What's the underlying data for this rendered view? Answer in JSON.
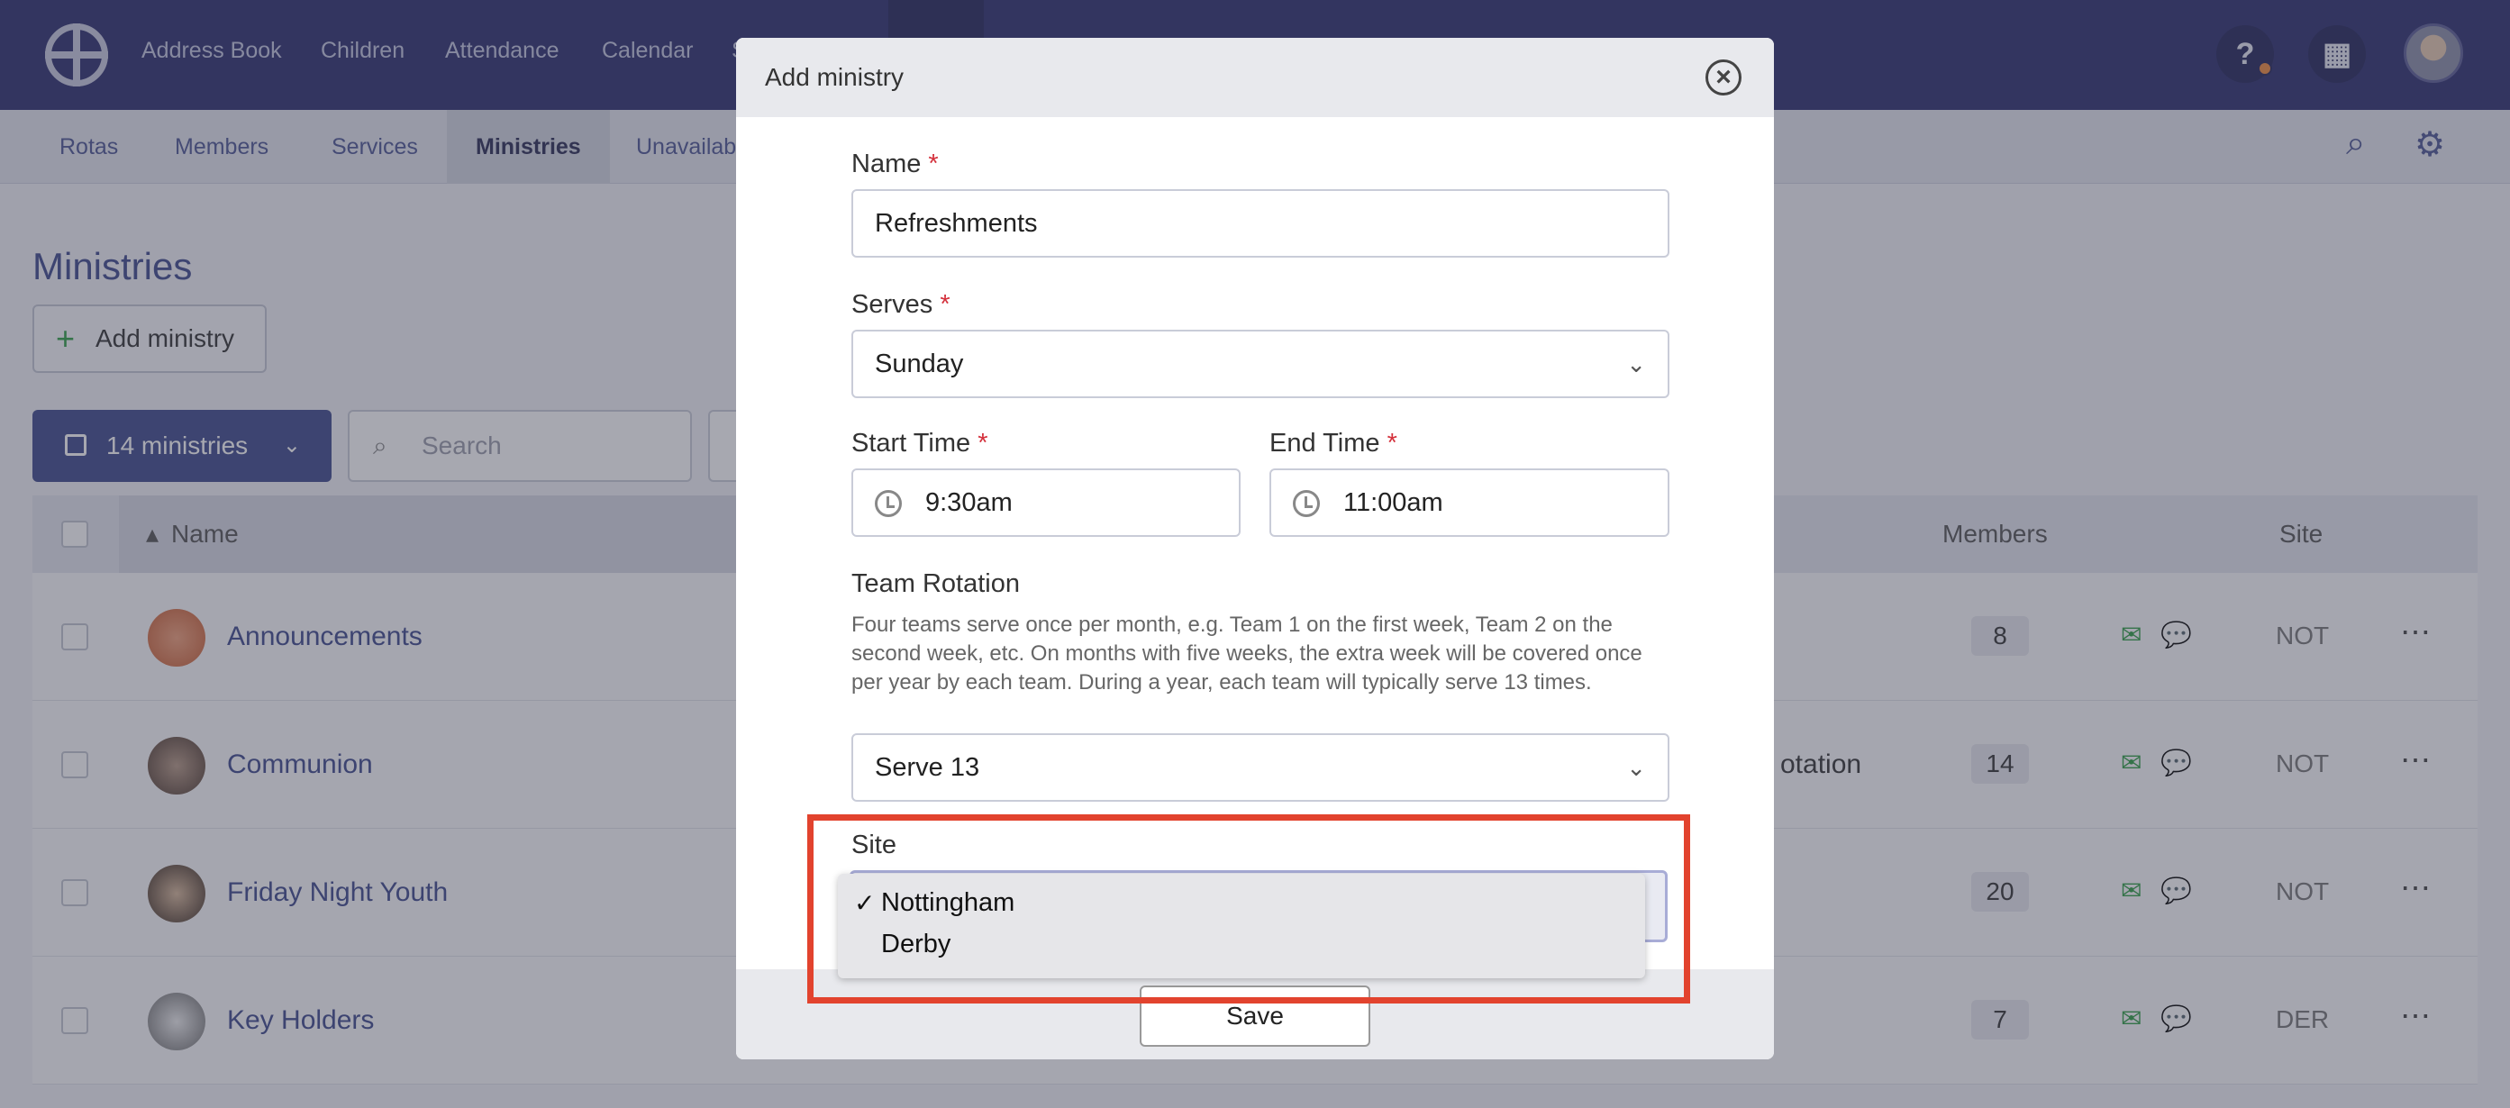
{
  "topnav": {
    "links": [
      "Address Book",
      "Children",
      "Attendance",
      "Calendar",
      "S"
    ],
    "help_icon": "question-icon",
    "org_icon": "building-icon"
  },
  "subnav": {
    "tabs": [
      "Rotas",
      "Members",
      "Services",
      "Ministries",
      "Unavailab"
    ],
    "active": "Ministries"
  },
  "page": {
    "title": "Ministries",
    "add_button": "Add ministry",
    "filter_button": "14 ministries",
    "search_placeholder": "Search"
  },
  "table": {
    "headers": {
      "name": "Name",
      "members": "Members",
      "site": "Site"
    },
    "rows": [
      {
        "name": "Announcements",
        "extra": "",
        "members": "8",
        "site": "NOT"
      },
      {
        "name": "Communion",
        "extra": "otation",
        "members": "14",
        "site": "NOT"
      },
      {
        "name": "Friday Night Youth",
        "extra": "",
        "members": "20",
        "site": "NOT"
      },
      {
        "name": "Key Holders",
        "extra": "",
        "members": "7",
        "site": "DER"
      }
    ]
  },
  "modal": {
    "title": "Add ministry",
    "name_label": "Name",
    "name_value": "Refreshments",
    "serves_label": "Serves",
    "serves_value": "Sunday",
    "start_label": "Start Time",
    "start_value": "9:30am",
    "end_label": "End Time",
    "end_value": "11:00am",
    "rotation_label": "Team Rotation",
    "rotation_help": "Four teams serve once per month, e.g. Team 1 on the first week, Team 2 on the second week, etc. On months with five weeks, the extra week will be covered once per year by each team. During a year, each team will typically serve 13 times.",
    "rotation_value": "Serve 13",
    "site_label": "Site",
    "site_options": [
      "Nottingham",
      "Derby"
    ],
    "site_selected": "Nottingham",
    "save_label": "Save",
    "required_marker": "*"
  },
  "colors": {
    "topnav": "#2d2f6e",
    "accent": "#3f4a8c",
    "required": "#d4313c",
    "highlight": "#e2432e"
  }
}
